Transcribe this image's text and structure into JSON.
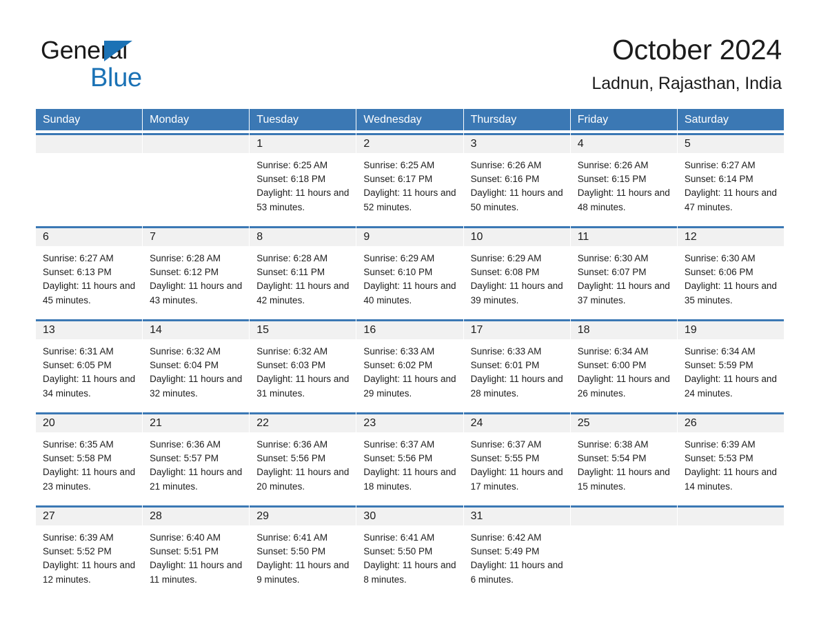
{
  "logo": {
    "text_part1": "General",
    "text_part2": "Blue",
    "triangle_icon": "triangle-icon",
    "brand_color": "#1b72b5"
  },
  "header": {
    "month_title": "October 2024",
    "location": "Ladnun, Rajasthan, India"
  },
  "calendar": {
    "header_color": "#3b78b4",
    "daynum_band_color": "#f1f1f1",
    "weekdays": [
      "Sunday",
      "Monday",
      "Tuesday",
      "Wednesday",
      "Thursday",
      "Friday",
      "Saturday"
    ],
    "weeks": [
      [
        {
          "day": "",
          "sunrise": "",
          "sunset": "",
          "daylight": ""
        },
        {
          "day": "",
          "sunrise": "",
          "sunset": "",
          "daylight": ""
        },
        {
          "day": "1",
          "sunrise": "Sunrise: 6:25 AM",
          "sunset": "Sunset: 6:18 PM",
          "daylight": "Daylight: 11 hours and 53 minutes."
        },
        {
          "day": "2",
          "sunrise": "Sunrise: 6:25 AM",
          "sunset": "Sunset: 6:17 PM",
          "daylight": "Daylight: 11 hours and 52 minutes."
        },
        {
          "day": "3",
          "sunrise": "Sunrise: 6:26 AM",
          "sunset": "Sunset: 6:16 PM",
          "daylight": "Daylight: 11 hours and 50 minutes."
        },
        {
          "day": "4",
          "sunrise": "Sunrise: 6:26 AM",
          "sunset": "Sunset: 6:15 PM",
          "daylight": "Daylight: 11 hours and 48 minutes."
        },
        {
          "day": "5",
          "sunrise": "Sunrise: 6:27 AM",
          "sunset": "Sunset: 6:14 PM",
          "daylight": "Daylight: 11 hours and 47 minutes."
        }
      ],
      [
        {
          "day": "6",
          "sunrise": "Sunrise: 6:27 AM",
          "sunset": "Sunset: 6:13 PM",
          "daylight": "Daylight: 11 hours and 45 minutes."
        },
        {
          "day": "7",
          "sunrise": "Sunrise: 6:28 AM",
          "sunset": "Sunset: 6:12 PM",
          "daylight": "Daylight: 11 hours and 43 minutes."
        },
        {
          "day": "8",
          "sunrise": "Sunrise: 6:28 AM",
          "sunset": "Sunset: 6:11 PM",
          "daylight": "Daylight: 11 hours and 42 minutes."
        },
        {
          "day": "9",
          "sunrise": "Sunrise: 6:29 AM",
          "sunset": "Sunset: 6:10 PM",
          "daylight": "Daylight: 11 hours and 40 minutes."
        },
        {
          "day": "10",
          "sunrise": "Sunrise: 6:29 AM",
          "sunset": "Sunset: 6:08 PM",
          "daylight": "Daylight: 11 hours and 39 minutes."
        },
        {
          "day": "11",
          "sunrise": "Sunrise: 6:30 AM",
          "sunset": "Sunset: 6:07 PM",
          "daylight": "Daylight: 11 hours and 37 minutes."
        },
        {
          "day": "12",
          "sunrise": "Sunrise: 6:30 AM",
          "sunset": "Sunset: 6:06 PM",
          "daylight": "Daylight: 11 hours and 35 minutes."
        }
      ],
      [
        {
          "day": "13",
          "sunrise": "Sunrise: 6:31 AM",
          "sunset": "Sunset: 6:05 PM",
          "daylight": "Daylight: 11 hours and 34 minutes."
        },
        {
          "day": "14",
          "sunrise": "Sunrise: 6:32 AM",
          "sunset": "Sunset: 6:04 PM",
          "daylight": "Daylight: 11 hours and 32 minutes."
        },
        {
          "day": "15",
          "sunrise": "Sunrise: 6:32 AM",
          "sunset": "Sunset: 6:03 PM",
          "daylight": "Daylight: 11 hours and 31 minutes."
        },
        {
          "day": "16",
          "sunrise": "Sunrise: 6:33 AM",
          "sunset": "Sunset: 6:02 PM",
          "daylight": "Daylight: 11 hours and 29 minutes."
        },
        {
          "day": "17",
          "sunrise": "Sunrise: 6:33 AM",
          "sunset": "Sunset: 6:01 PM",
          "daylight": "Daylight: 11 hours and 28 minutes."
        },
        {
          "day": "18",
          "sunrise": "Sunrise: 6:34 AM",
          "sunset": "Sunset: 6:00 PM",
          "daylight": "Daylight: 11 hours and 26 minutes."
        },
        {
          "day": "19",
          "sunrise": "Sunrise: 6:34 AM",
          "sunset": "Sunset: 5:59 PM",
          "daylight": "Daylight: 11 hours and 24 minutes."
        }
      ],
      [
        {
          "day": "20",
          "sunrise": "Sunrise: 6:35 AM",
          "sunset": "Sunset: 5:58 PM",
          "daylight": "Daylight: 11 hours and 23 minutes."
        },
        {
          "day": "21",
          "sunrise": "Sunrise: 6:36 AM",
          "sunset": "Sunset: 5:57 PM",
          "daylight": "Daylight: 11 hours and 21 minutes."
        },
        {
          "day": "22",
          "sunrise": "Sunrise: 6:36 AM",
          "sunset": "Sunset: 5:56 PM",
          "daylight": "Daylight: 11 hours and 20 minutes."
        },
        {
          "day": "23",
          "sunrise": "Sunrise: 6:37 AM",
          "sunset": "Sunset: 5:56 PM",
          "daylight": "Daylight: 11 hours and 18 minutes."
        },
        {
          "day": "24",
          "sunrise": "Sunrise: 6:37 AM",
          "sunset": "Sunset: 5:55 PM",
          "daylight": "Daylight: 11 hours and 17 minutes."
        },
        {
          "day": "25",
          "sunrise": "Sunrise: 6:38 AM",
          "sunset": "Sunset: 5:54 PM",
          "daylight": "Daylight: 11 hours and 15 minutes."
        },
        {
          "day": "26",
          "sunrise": "Sunrise: 6:39 AM",
          "sunset": "Sunset: 5:53 PM",
          "daylight": "Daylight: 11 hours and 14 minutes."
        }
      ],
      [
        {
          "day": "27",
          "sunrise": "Sunrise: 6:39 AM",
          "sunset": "Sunset: 5:52 PM",
          "daylight": "Daylight: 11 hours and 12 minutes."
        },
        {
          "day": "28",
          "sunrise": "Sunrise: 6:40 AM",
          "sunset": "Sunset: 5:51 PM",
          "daylight": "Daylight: 11 hours and 11 minutes."
        },
        {
          "day": "29",
          "sunrise": "Sunrise: 6:41 AM",
          "sunset": "Sunset: 5:50 PM",
          "daylight": "Daylight: 11 hours and 9 minutes."
        },
        {
          "day": "30",
          "sunrise": "Sunrise: 6:41 AM",
          "sunset": "Sunset: 5:50 PM",
          "daylight": "Daylight: 11 hours and 8 minutes."
        },
        {
          "day": "31",
          "sunrise": "Sunrise: 6:42 AM",
          "sunset": "Sunset: 5:49 PM",
          "daylight": "Daylight: 11 hours and 6 minutes."
        },
        {
          "day": "",
          "sunrise": "",
          "sunset": "",
          "daylight": ""
        },
        {
          "day": "",
          "sunrise": "",
          "sunset": "",
          "daylight": ""
        }
      ]
    ]
  }
}
